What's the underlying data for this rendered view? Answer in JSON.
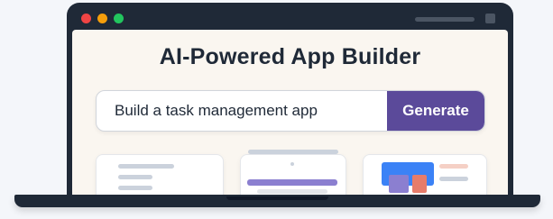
{
  "window": {
    "traffic_lights": [
      "#ef4444",
      "#f59e0b",
      "#22c55e"
    ]
  },
  "header": {
    "title": "AI-Powered App Builder"
  },
  "prompt": {
    "value": "Build a task management app",
    "button_label": "Generate"
  },
  "colors": {
    "accent": "#5b4a9a",
    "accent_light": "#8b7fd0",
    "preview_blue": "#3b82f6",
    "preview_coral": "#e77c6a"
  }
}
